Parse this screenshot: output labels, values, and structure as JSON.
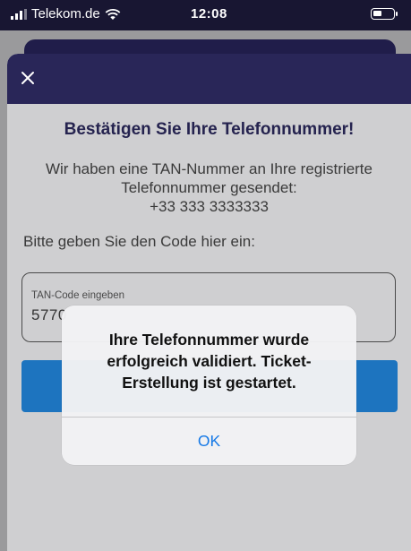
{
  "status_bar": {
    "carrier": "Telekom.de",
    "time": "12:08"
  },
  "screen": {
    "title": "Bestätigen Sie Ihre Telefonnummer!",
    "info_lines": [
      "Wir haben eine TAN-Nummer an Ihre registrierte",
      "Telefonnummer gesendet:",
      "+33 333 3333333"
    ],
    "prompt": "Bitte geben Sie den Code hier ein:",
    "tan_field": {
      "label": "TAN-Code eingeben",
      "value": "5770"
    }
  },
  "alert": {
    "message_lines": [
      "Ihre Telefonnummer wurde",
      "erfolgreich validiert. Ticket-",
      "Erstellung ist gestartet."
    ],
    "ok_label": "OK"
  },
  "colors": {
    "header_navy": "#292658",
    "primary_blue": "#1d74bf",
    "ios_link_blue": "#1478e6"
  }
}
